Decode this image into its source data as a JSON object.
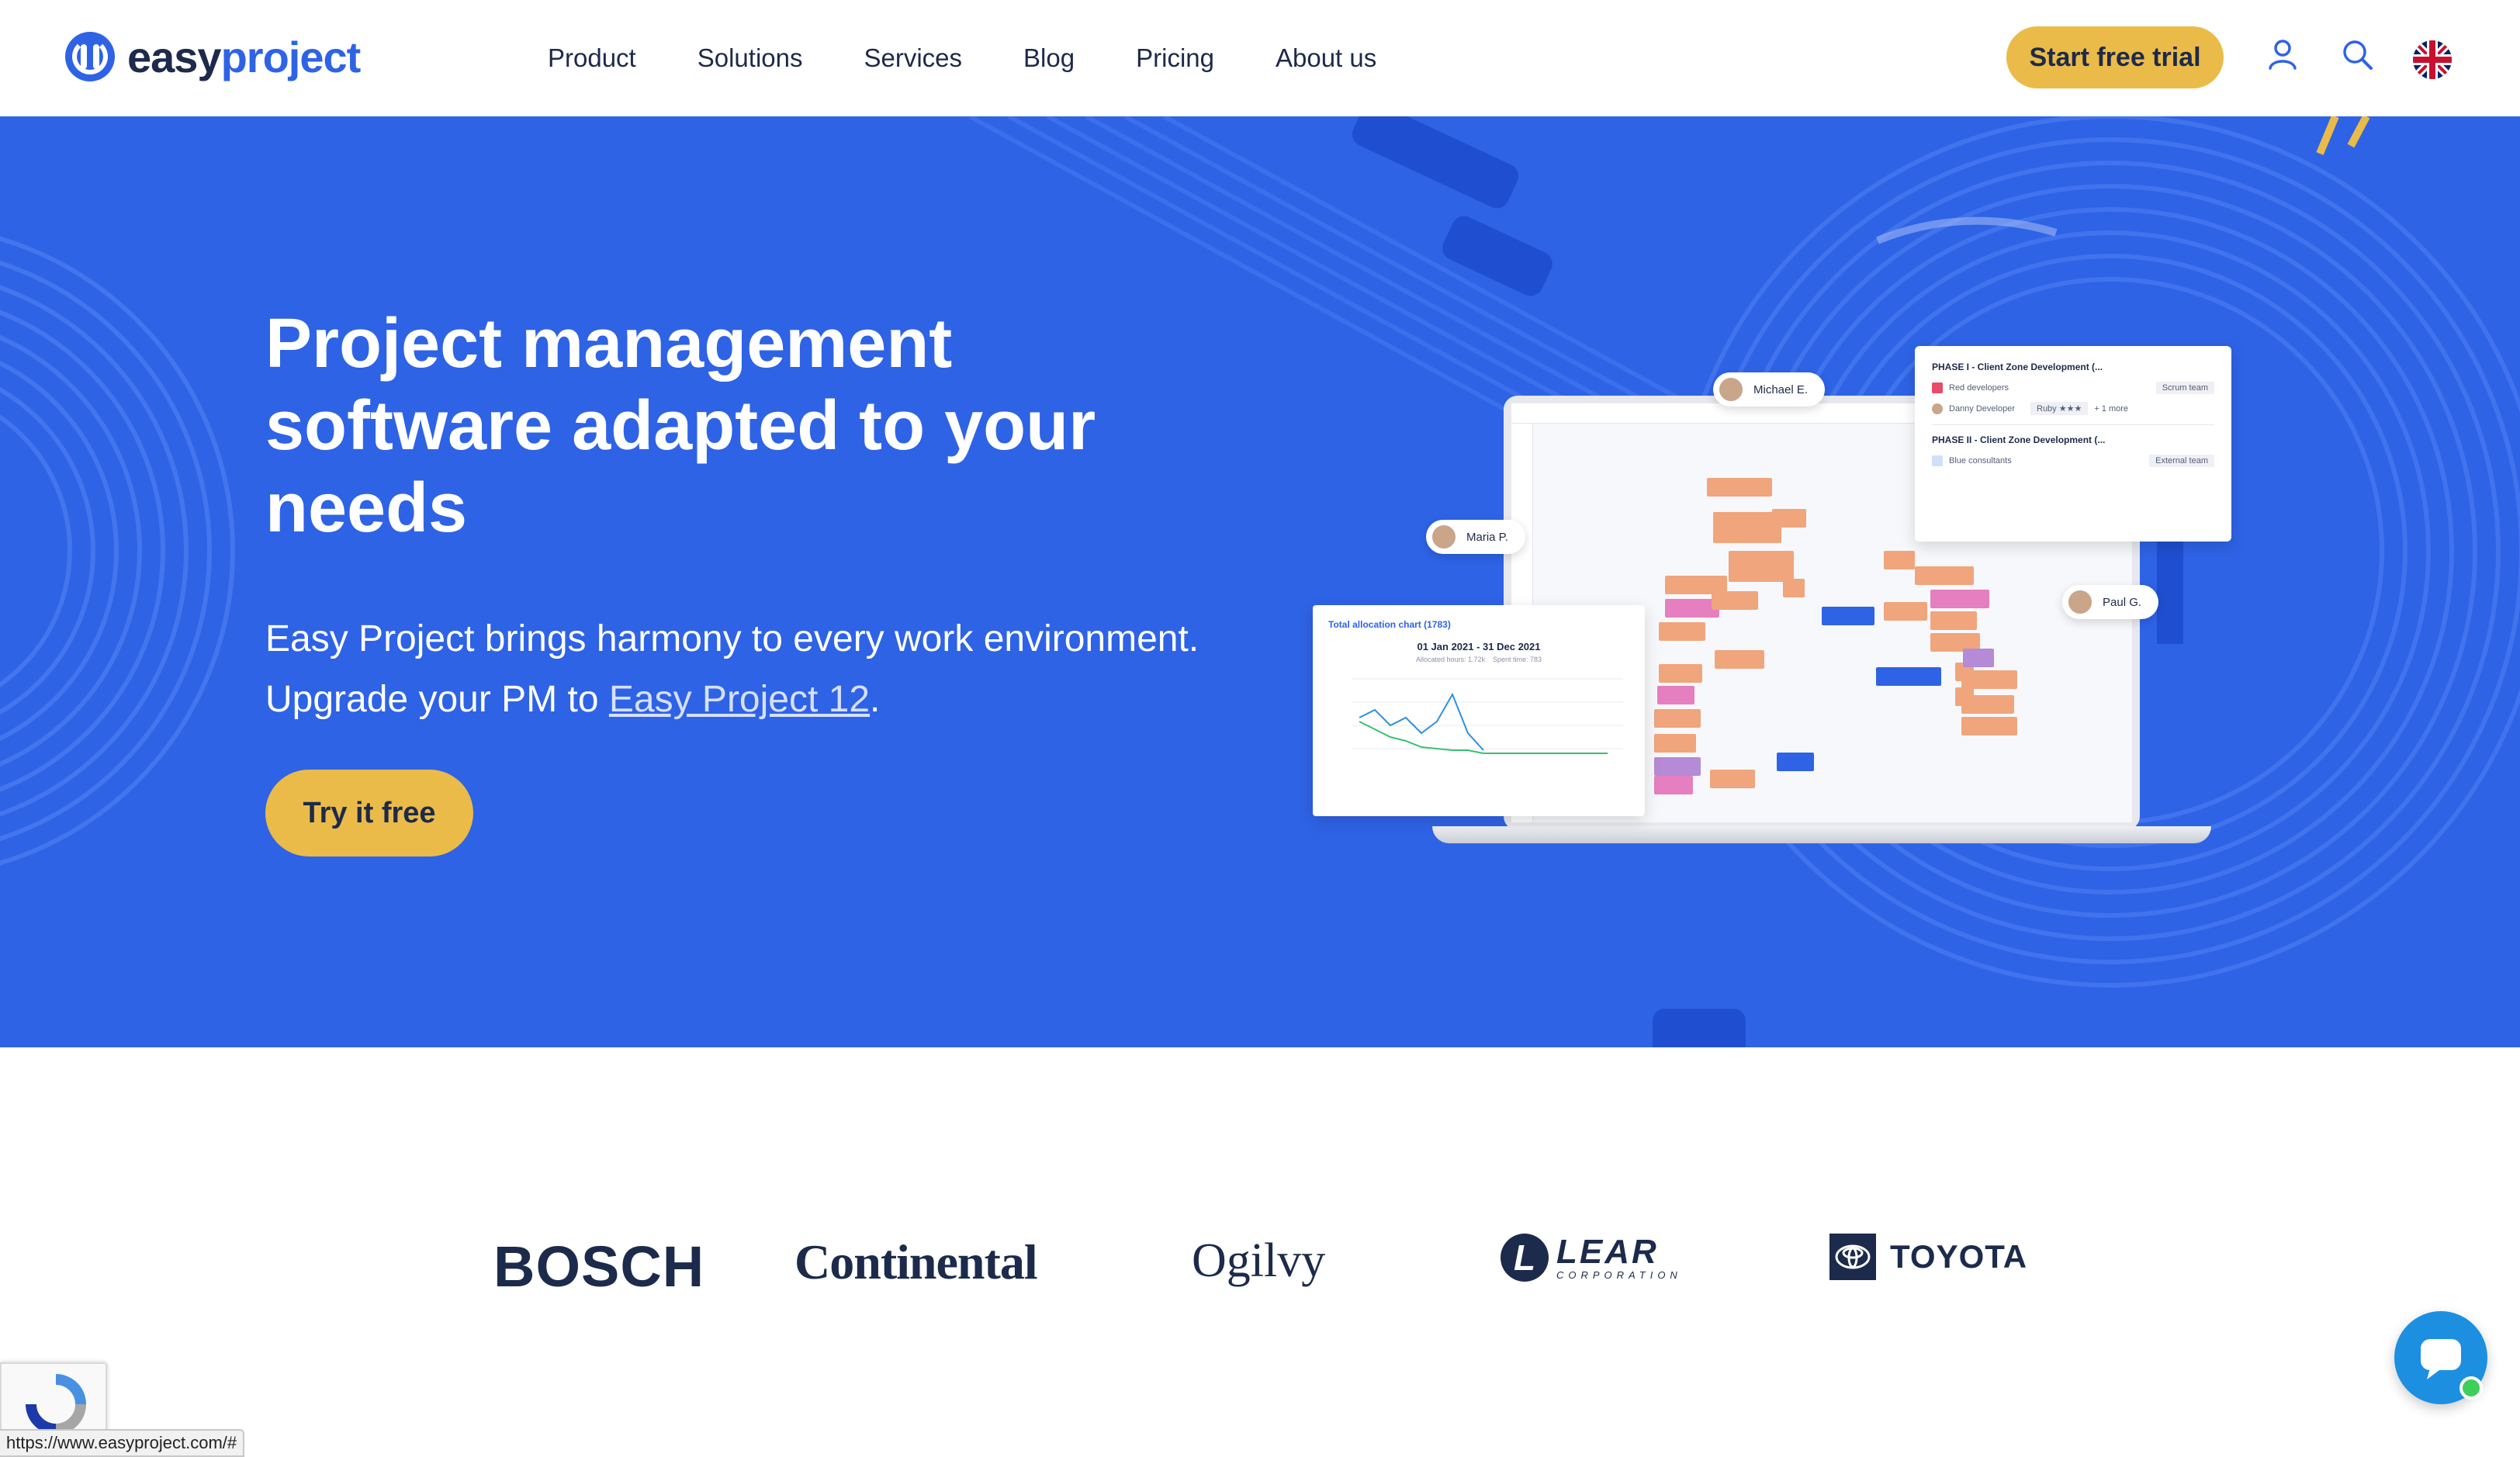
{
  "header": {
    "logo": {
      "easy": "easy",
      "project": "project"
    },
    "nav": [
      "Product",
      "Solutions",
      "Services",
      "Blog",
      "Pricing",
      "About us"
    ],
    "cta": "Start free trial",
    "icons": [
      "user-icon",
      "search-icon",
      "uk-flag-icon"
    ]
  },
  "hero": {
    "title_lines": [
      "Project management",
      "software adapted to your",
      "needs"
    ],
    "subtitle_line1": "Easy Project brings harmony to every work environment.",
    "subtitle_line2_prefix": "Upgrade your PM to ",
    "subtitle_link": "Easy Project 12",
    "subtitle_line2_suffix": ".",
    "cta": "Try it free",
    "background_color": "#2e63e6",
    "accent_color": "#eabb48"
  },
  "mockup": {
    "tags": {
      "michael": "Michael E.",
      "maria": "Maria P.",
      "paul": "Paul G."
    },
    "phase_card": {
      "phase1": "PHASE I - Client Zone Development (...",
      "team1": "Red developers",
      "team1_badge": "Scrum team",
      "person": "Danny Developer",
      "person_skill": "Ruby ★★★",
      "person_more": "+ 1 more",
      "phase2": "PHASE II - Client Zone Development (...",
      "team2": "Blue consultants",
      "team2_badge": "External team"
    },
    "chart_card": {
      "title": "Total allocation chart (1783)",
      "range": "01 Jan 2021 - 31 Dec 2021",
      "allocated": "Allocated hours: 1.72k",
      "spent": "Spent time: 783"
    }
  },
  "logos": {
    "bosch": "BOSCH",
    "continental": "Continental",
    "ogilvy": "Ogilvy",
    "lear": "LEAR",
    "lear_sub": "CORPORATION",
    "toyota": "TOYOTA"
  },
  "status_bar": {
    "url": "https://www.easyproject.com/#"
  }
}
